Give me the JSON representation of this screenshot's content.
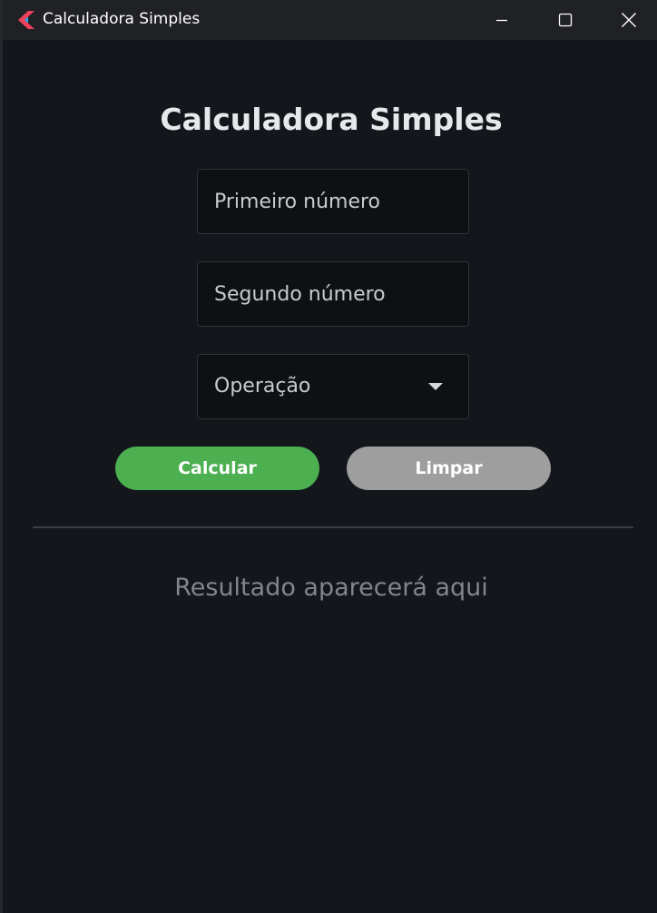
{
  "window": {
    "title": "Calculadora Simples",
    "controls": [
      "minimize-icon",
      "maximize-icon",
      "close-icon"
    ]
  },
  "app": {
    "heading": "Calculadora Simples",
    "first_input": {
      "placeholder": "Primeiro número",
      "value": ""
    },
    "second_input": {
      "placeholder": "Segundo número",
      "value": ""
    },
    "operation_select": {
      "label": "Operação",
      "icon": "caret-down-icon"
    },
    "buttons": {
      "calculate": "Calcular",
      "clear": "Limpar"
    },
    "result_text": "Resultado aparecerá aqui"
  },
  "colors": {
    "background": "#13161b",
    "titlebar": "#202124",
    "calculate_button": "#4caf50",
    "clear_button": "#9e9e9e",
    "result_text": "#82858a"
  }
}
